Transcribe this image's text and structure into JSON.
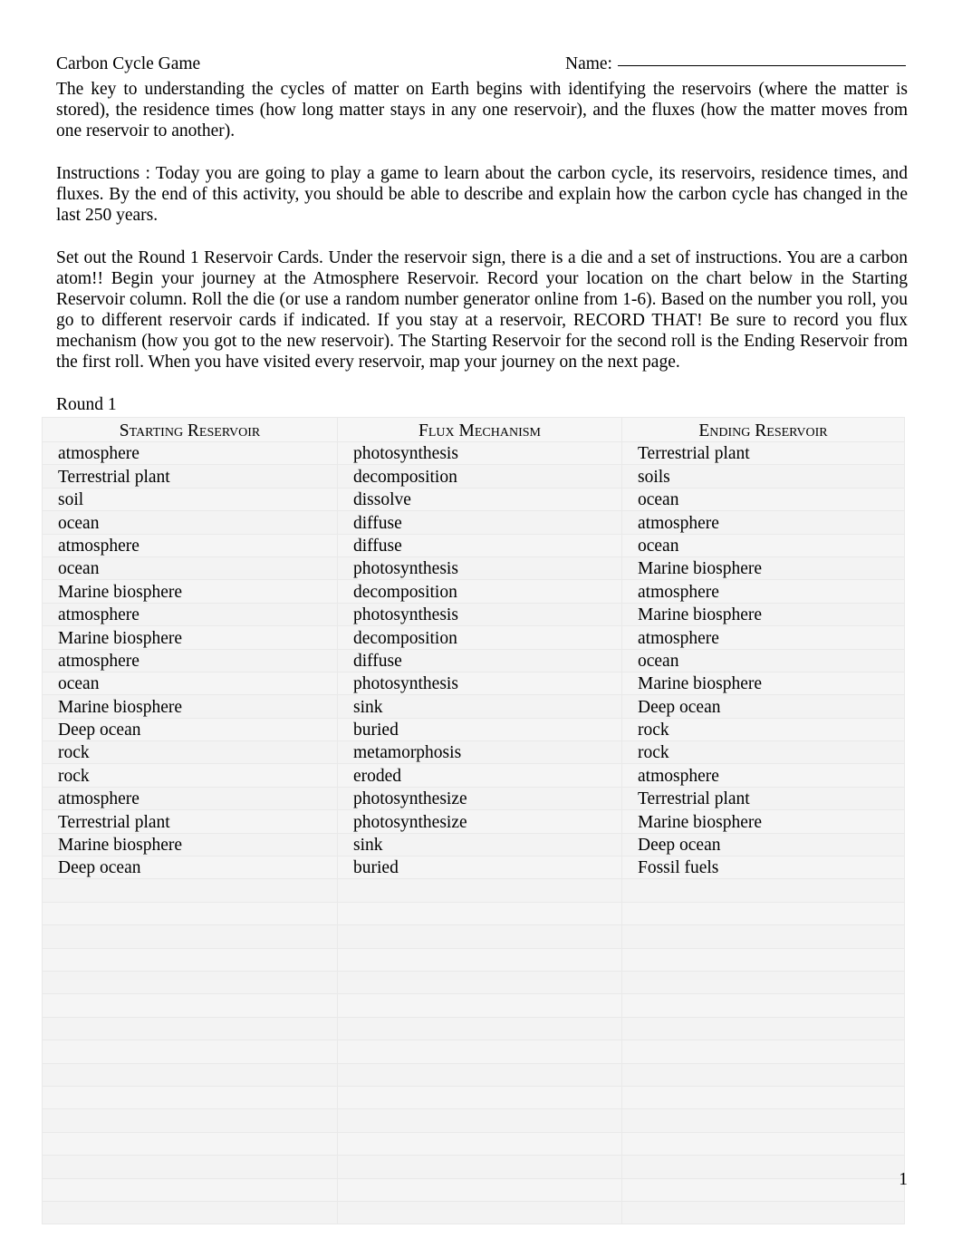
{
  "document": {
    "title": "Carbon Cycle Game",
    "name_label": "Name:",
    "page_number": "1",
    "round_label": "Round 1"
  },
  "paragraphs": {
    "intro": "The key to understanding the cycles of matter on Earth begins with identifying the  reservoirs (where the matter is stored), the  residence times (how long matter stays in any one reservoir), and the  fluxes (how the matter moves from one reservoir to another).",
    "instructions": "Instructions : Today you are going to play a game to learn about the carbon cycle, its reservoirs, residence times, and fluxes. By the end of this activity, you should be able to describe and explain how the carbon cycle has changed in the last 250 years.",
    "setout": "Set out the Round 1 Reservoir Cards.  Under the reservoir sign, there is a die and a set of instructions.    You are a carbon atom!!  Begin your journey at the Atmosphere Reservoir.   Record your location on the chart below in the Starting Reservoir column.  Roll the die (or use a random number generator online from 1-6).   Based on the number you roll, you go to different reservoir cards if indicated.   If you stay at a reservoir, RECORD THAT! Be sure to record you flux mechanism (how you got to the new reservoir). The Starting Reservoir for the second roll is the Ending Reservoir from the first roll. When you have visited every reservoir, map your journey on the next page."
  },
  "table": {
    "headers": [
      "Starting Reservoir",
      "Flux Mechanism",
      "Ending Reservoir"
    ],
    "rows": [
      [
        "atmosphere",
        "photosynthesis",
        "Terrestrial plant"
      ],
      [
        "Terrestrial plant",
        "decomposition",
        "soils"
      ],
      [
        "soil",
        "dissolve",
        "ocean"
      ],
      [
        "ocean",
        "diffuse",
        "atmosphere"
      ],
      [
        "atmosphere",
        "diffuse",
        "ocean"
      ],
      [
        "ocean",
        "photosynthesis",
        "Marine biosphere"
      ],
      [
        "Marine biosphere",
        "decomposition",
        "atmosphere"
      ],
      [
        "atmosphere",
        "photosynthesis",
        "Marine biosphere"
      ],
      [
        "Marine biosphere",
        "decomposition",
        "atmosphere"
      ],
      [
        "atmosphere",
        "diffuse",
        "ocean"
      ],
      [
        "ocean",
        "photosynthesis",
        "Marine biosphere"
      ],
      [
        "Marine biosphere",
        "sink",
        "Deep ocean"
      ],
      [
        "Deep ocean",
        "buried",
        "rock"
      ],
      [
        "rock",
        "metamorphosis",
        "rock"
      ],
      [
        "rock",
        "eroded",
        "atmosphere"
      ],
      [
        "atmosphere",
        "photosynthesize",
        "Terrestrial plant"
      ],
      [
        "Terrestrial plant",
        "photosynthesize",
        "Marine biosphere"
      ],
      [
        "Marine biosphere",
        "sink",
        "Deep ocean"
      ],
      [
        "Deep ocean",
        "buried",
        "Fossil fuels"
      ],
      [
        "",
        "",
        ""
      ],
      [
        "",
        "",
        ""
      ],
      [
        "",
        "",
        ""
      ],
      [
        "",
        "",
        ""
      ],
      [
        "",
        "",
        ""
      ],
      [
        "",
        "",
        ""
      ],
      [
        "",
        "",
        ""
      ],
      [
        "",
        "",
        ""
      ],
      [
        "",
        "",
        ""
      ],
      [
        "",
        "",
        ""
      ],
      [
        "",
        "",
        ""
      ],
      [
        "",
        "",
        ""
      ],
      [
        "",
        "",
        ""
      ],
      [
        "",
        "",
        ""
      ],
      [
        "",
        "",
        ""
      ]
    ]
  }
}
